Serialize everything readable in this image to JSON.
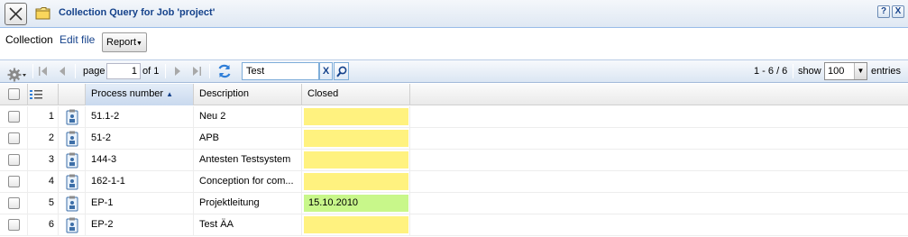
{
  "window": {
    "title": "Collection Query for Job 'project'",
    "help_label": "?",
    "close_label": "X"
  },
  "menu": {
    "collection": "Collection",
    "edit_file": "Edit file",
    "report": "Report"
  },
  "toolbar": {
    "page_label": "page",
    "page_value": "1",
    "of_label": "of 1",
    "search_value": "Test",
    "clear_label": "X",
    "range_label": "1 - 6 / 6",
    "show_label": "show",
    "show_value": "100",
    "entries_label": "entries"
  },
  "grid": {
    "columns": {
      "process_number": "Process number",
      "description": "Description",
      "closed": "Closed"
    },
    "rows": [
      {
        "num": "1",
        "process": "51.1-2",
        "description": "Neu 2",
        "closed": "",
        "status": "open"
      },
      {
        "num": "2",
        "process": "51-2",
        "description": "APB",
        "closed": "",
        "status": "open"
      },
      {
        "num": "3",
        "process": "144-3",
        "description": "Antesten Testsystem",
        "closed": "",
        "status": "open"
      },
      {
        "num": "4",
        "process": "162-1-1",
        "description": "Conception for com...",
        "closed": "",
        "status": "open"
      },
      {
        "num": "5",
        "process": "EP-1",
        "description": "Projektleitung",
        "closed": "15.10.2010",
        "status": "closed"
      },
      {
        "num": "6",
        "process": "EP-2",
        "description": "Test ÄA",
        "closed": "",
        "status": "open"
      }
    ]
  },
  "colors": {
    "open": "#fff27f",
    "closed": "#c8f78a",
    "accent": "#15428b"
  }
}
